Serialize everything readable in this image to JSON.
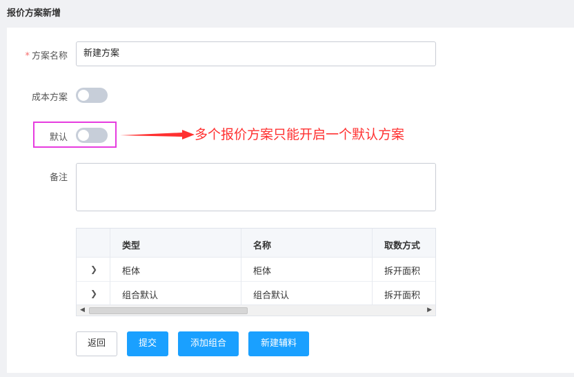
{
  "page": {
    "title": "报价方案新增"
  },
  "form": {
    "name_label": "方案名称",
    "required_mark": "*",
    "name_value": "新建方案",
    "cost_label": "成本方案",
    "cost_on": false,
    "default_label": "默认",
    "default_on": false,
    "remark_label": "备注",
    "remark_value": ""
  },
  "annotation": {
    "text": "多个报价方案只能开启一个默认方案",
    "color": "#ff3030",
    "box_color": "#e63bdf"
  },
  "table": {
    "columns": [
      "类型",
      "名称",
      "取数方式"
    ],
    "rows": [
      {
        "type": "柜体",
        "name": "柜体",
        "method": "拆开面积"
      },
      {
        "type": "组合默认",
        "name": "组合默认",
        "method": "拆开面积"
      }
    ]
  },
  "buttons": {
    "back": "返回",
    "submit": "提交",
    "add_group": "添加组合",
    "new_material": "新建辅料"
  },
  "colors": {
    "primary": "#1aa0ff",
    "switch_off": "#c7ced9"
  }
}
